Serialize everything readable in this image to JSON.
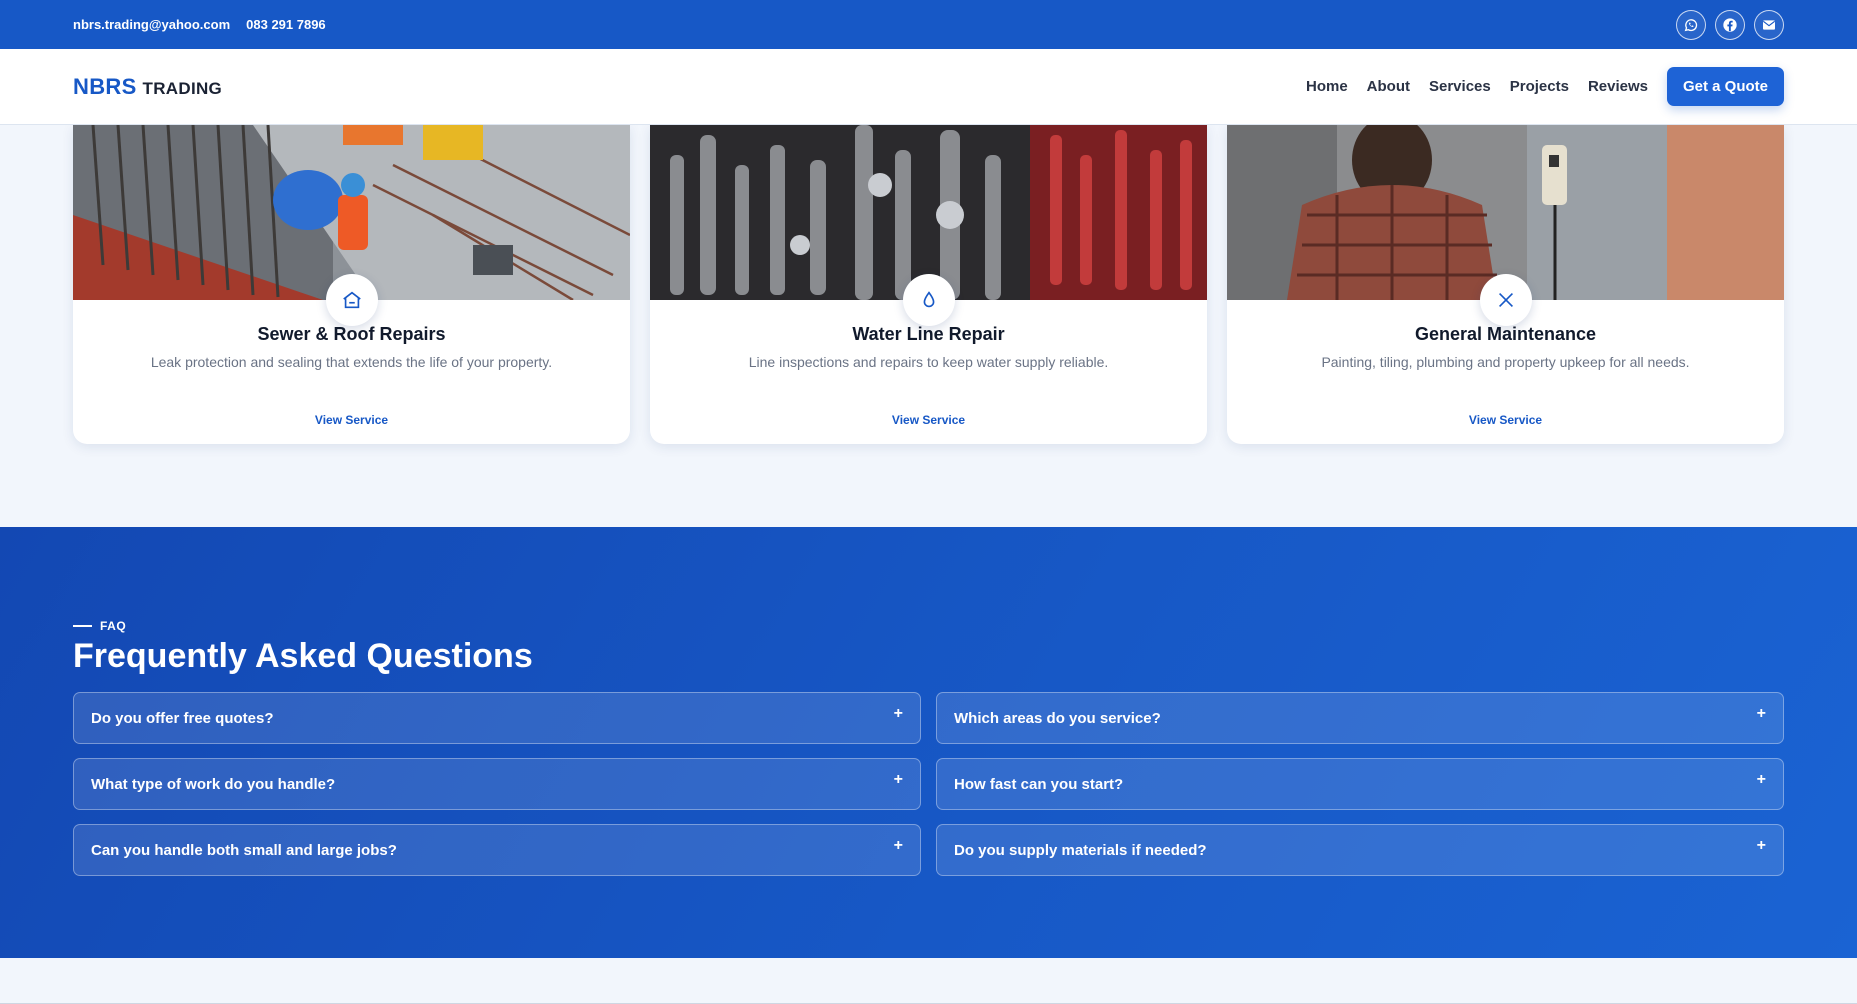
{
  "topbar": {
    "email": "nbrs.trading@yahoo.com",
    "phone": "083 291 7896",
    "socials": [
      {
        "icon": "whatsapp-icon"
      },
      {
        "icon": "facebook-icon"
      },
      {
        "icon": "mail-icon"
      }
    ]
  },
  "nav": {
    "logo_brand": "NBRS",
    "logo_sub": "TRADING",
    "links": [
      "Home",
      "About",
      "Services",
      "Projects",
      "Reviews"
    ],
    "cta": "Get a Quote"
  },
  "services": [
    {
      "title": "Sewer & Roof Repairs",
      "desc": "Leak protection and sealing that extends the life of your property.",
      "link": "View Service",
      "icon": "house-icon"
    },
    {
      "title": "Water Line Repair",
      "desc": "Line inspections and repairs to keep water supply reliable.",
      "link": "View Service",
      "icon": "water-drop-icon"
    },
    {
      "title": "General Maintenance",
      "desc": "Painting, tiling, plumbing and property upkeep for all needs.",
      "link": "View Service",
      "icon": "tools-icon"
    }
  ],
  "faq": {
    "eyebrow": "FAQ",
    "title": "Frequently Asked Questions",
    "items": [
      "Do you offer free quotes?",
      "Which areas do you service?",
      "What type of work do you handle?",
      "How fast can you start?",
      "Can you handle both small and large jobs?",
      "Do you supply materials if needed?"
    ],
    "toggle_symbol": "+"
  },
  "colors": {
    "primary": "#1758c6",
    "page_bg": "#f2f6fc",
    "text_dark": "#111a2c",
    "text_muted": "#6a7385"
  }
}
